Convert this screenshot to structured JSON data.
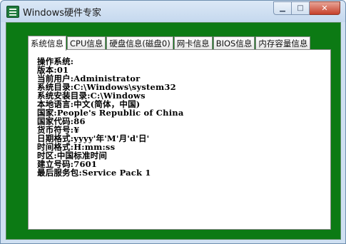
{
  "window": {
    "title": "Windows硬件专家",
    "buttons": {
      "minimize": "▁",
      "maximize": "□",
      "close": "✕"
    }
  },
  "tabs": [
    {
      "label": "系统信息",
      "active": true
    },
    {
      "label": "CPU信息",
      "active": false
    },
    {
      "label": "硬盘信息(磁盘0)",
      "active": false
    },
    {
      "label": "网卡信息",
      "active": false
    },
    {
      "label": "BIOS信息",
      "active": false
    },
    {
      "label": "内存容量信息",
      "active": false
    }
  ],
  "system_info": [
    "操作系统:",
    "版本:01",
    "当前用户:Administrator",
    "系统目录:C:\\Windows\\system32",
    "系统安装目录:C:\\Windows",
    "本地语言:中文(简体，中国)",
    "国家:People's Republic of China",
    "国家代码:86",
    "货币符号:¥",
    "日期格式:yyyy'年'M'月'd'日'",
    "时间格式:H:mm:ss",
    "时区:中国标准时间",
    "建立号码:7601",
    "最后服务包:Service Pack 1"
  ],
  "colors": {
    "client_background": "#0c7a14",
    "titlebar": "#cfe0f2",
    "panel": "#ffffff"
  },
  "icons": {
    "app": "app-icon",
    "minimize": "minimize-icon",
    "maximize": "maximize-icon",
    "close": "close-icon"
  }
}
